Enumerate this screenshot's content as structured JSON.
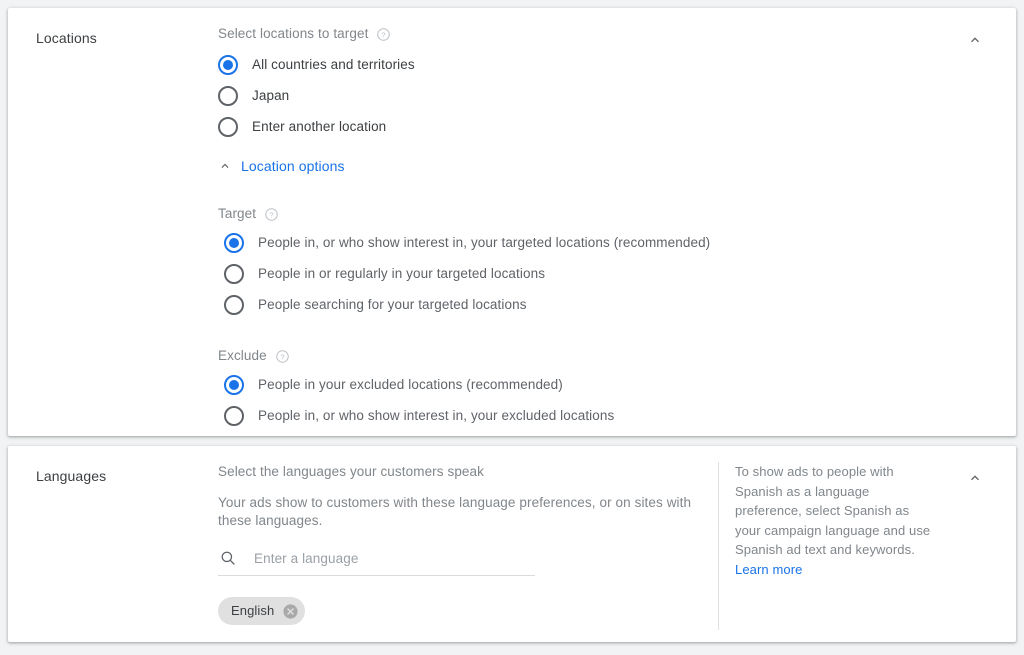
{
  "colors": {
    "accent": "#1a73e8",
    "label_dark": "#3c4043",
    "label_muted": "#5f6368",
    "label_light": "#80868b",
    "chip_bg": "#e0e0e0",
    "page_bg": "#f1f3f4"
  },
  "locations": {
    "section_label": "Locations",
    "collapse_icon": "chevron-up-icon",
    "select_label": "Select locations to target",
    "select_help_icon": "help-circle-icon",
    "options": [
      {
        "label": "All countries and territories",
        "checked": true
      },
      {
        "label": "Japan",
        "checked": false
      },
      {
        "label": "Enter another location",
        "checked": false
      }
    ],
    "options_toggle": {
      "label": "Location options",
      "icon": "chevron-up-icon",
      "expanded": true
    },
    "target": {
      "label": "Target",
      "help_icon": "help-circle-icon",
      "options": [
        {
          "label": "People in, or who show interest in, your targeted locations (recommended)",
          "checked": true
        },
        {
          "label": "People in or regularly in your targeted locations",
          "checked": false
        },
        {
          "label": "People searching for your targeted locations",
          "checked": false
        }
      ]
    },
    "exclude": {
      "label": "Exclude",
      "help_icon": "help-circle-icon",
      "options": [
        {
          "label": "People in your excluded locations (recommended)",
          "checked": true
        },
        {
          "label": "People in, or who show interest in, your excluded locations",
          "checked": false
        }
      ]
    }
  },
  "languages": {
    "section_label": "Languages",
    "collapse_icon": "chevron-up-icon",
    "title": "Select the languages your customers speak",
    "description": "Your ads show to customers with these language preferences, or on sites with these languages.",
    "search": {
      "icon": "search-icon",
      "placeholder": "Enter a language",
      "value": ""
    },
    "chips": [
      {
        "label": "English",
        "remove_icon": "close-circle-icon"
      }
    ],
    "aside": {
      "text": "To show ads to people with Spanish as a language preference, select Spanish as your campaign language and use Spanish ad text and keywords.",
      "link_label": "Learn more"
    }
  }
}
